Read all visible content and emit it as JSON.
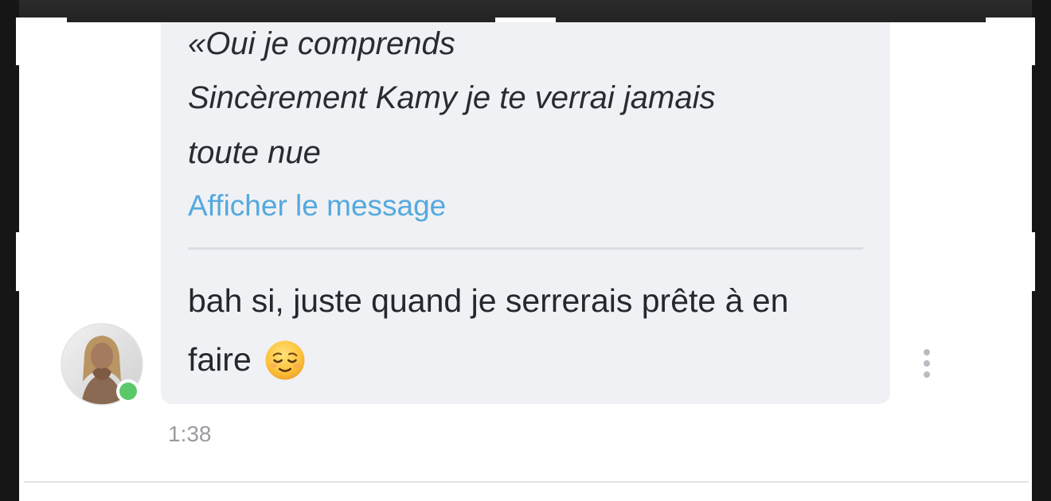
{
  "quoted_message": {
    "lines": [
      "«Oui je comprends",
      "Sincèrement Kamy je te verrai jamais",
      "toute nue"
    ],
    "show_message_label": "Afficher le message"
  },
  "reply": {
    "lines": [
      "bah si, juste quand je serrerais prête à en",
      "faire"
    ],
    "emoji": "relieved-face-emoji"
  },
  "sender": {
    "avatar_icon": "user-avatar-photo",
    "online_status_color": "#5bc86a"
  },
  "message_meta": {
    "time": "1:38"
  },
  "actions": {
    "more_icon": "vertical-ellipsis-icon"
  },
  "colors": {
    "bubble_bg": "#f0f1f4",
    "link": "#55a9de",
    "text": "#26272c",
    "timestamp": "#9a9ba1"
  }
}
